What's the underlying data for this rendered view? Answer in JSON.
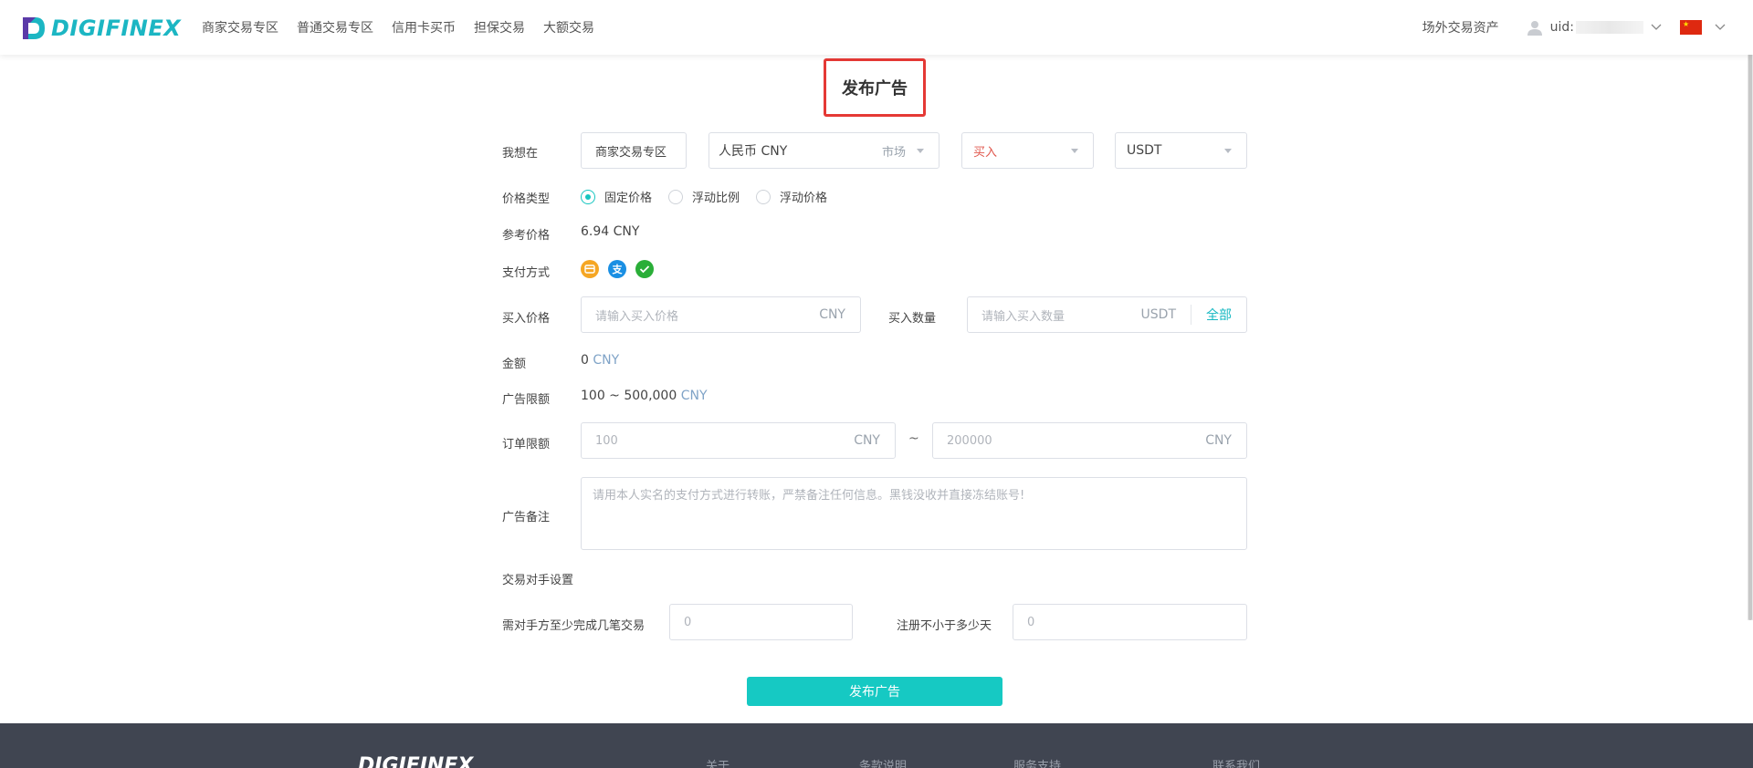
{
  "header": {
    "logo": "DIGIFINEX",
    "nav": [
      "商家交易专区",
      "普通交易专区",
      "信用卡买币",
      "担保交易",
      "大额交易"
    ],
    "assets": "场外交易资产",
    "uid_label": "uid:"
  },
  "page_title": "发布广告",
  "form": {
    "want_label": "我想在",
    "zone_value": "商家交易专区",
    "currency_value": "人民币 CNY",
    "currency_tag": "市场",
    "side_value": "买入",
    "coin_value": "USDT",
    "price_type_label": "价格类型",
    "price_types": [
      "固定价格",
      "浮动比例",
      "浮动价格"
    ],
    "ref_price_label": "参考价格",
    "ref_price_value": "6.94 CNY",
    "payment_label": "支付方式",
    "buy_price_label": "买入价格",
    "buy_price_placeholder": "请输入买入价格",
    "buy_price_unit": "CNY",
    "buy_qty_label": "买入数量",
    "buy_qty_placeholder": "请输入买入数量",
    "buy_qty_unit": "USDT",
    "all_label": "全部",
    "amount_label": "金额",
    "amount_value": "0",
    "amount_unit": "CNY",
    "ad_limit_label": "广告限额",
    "ad_limit_value": "100 ~ 500,000",
    "ad_limit_unit": "CNY",
    "order_limit_label": "订单限额",
    "order_min": "100",
    "order_max": "200000",
    "order_unit": "CNY",
    "tilde": "~",
    "remark_label": "广告备注",
    "remark_placeholder": "请用本人实名的支付方式进行转账，严禁备注任何信息。黑钱没收并直接冻结账号!",
    "counterparty_label": "交易对手设置",
    "min_trades_label": "需对手方至少完成几笔交易",
    "min_trades_value": "0",
    "min_days_label": "注册不小于多少天",
    "min_days_value": "0",
    "submit_label": "发布广告"
  },
  "footer": {
    "logo": "DIGIFINEX",
    "links": [
      "关于",
      "条款说明",
      "服务支持",
      "联系我们"
    ]
  },
  "colors": {
    "accent": "#16c9c3",
    "buy": "#e0564c",
    "footer": "#404551"
  }
}
